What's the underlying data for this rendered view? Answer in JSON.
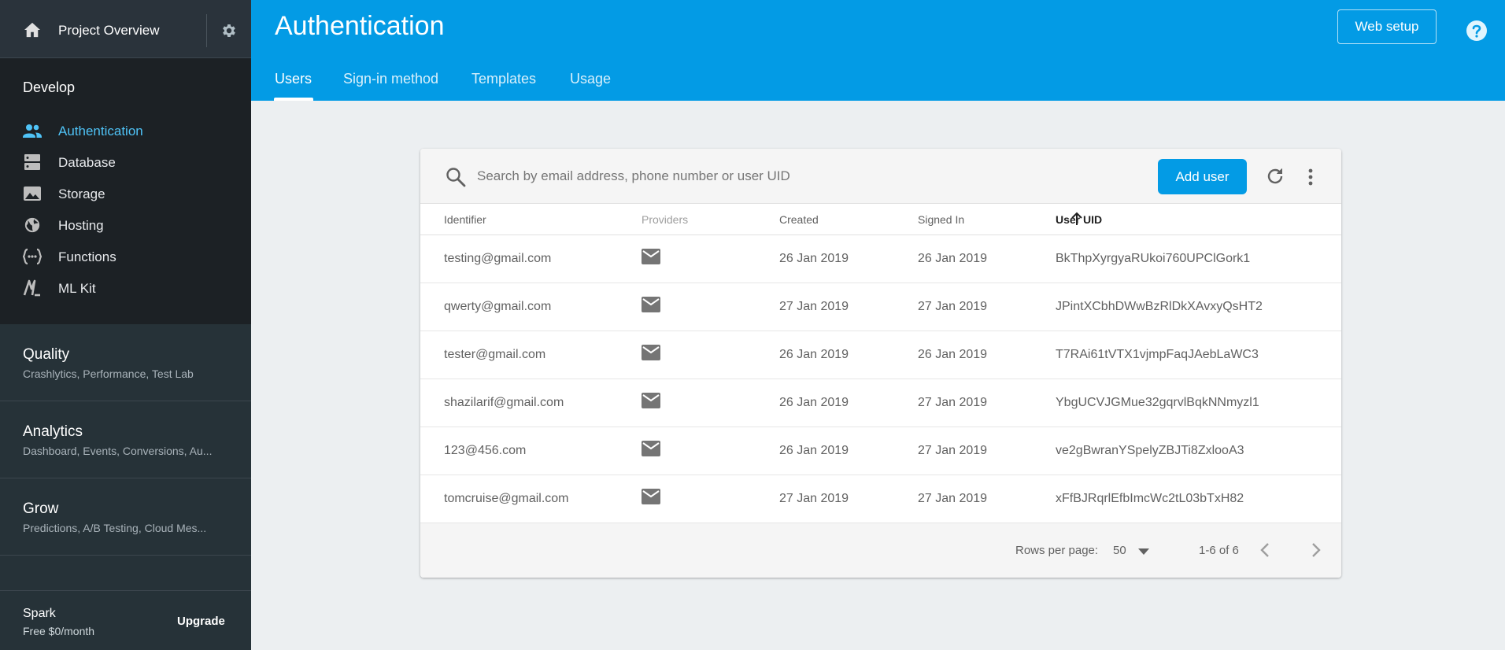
{
  "colors": {
    "header_blue": "#039be5",
    "sidebar_dark": "#263238",
    "sidebar_darker": "#1c2125",
    "active_accent": "#4fc3f7",
    "page_bg": "#eceff1"
  },
  "sidebar": {
    "project_label": "Project Overview",
    "develop": {
      "title": "Develop",
      "items": [
        {
          "label": "Authentication",
          "icon": "people-icon",
          "active": true
        },
        {
          "label": "Database",
          "icon": "database-icon"
        },
        {
          "label": "Storage",
          "icon": "image-icon"
        },
        {
          "label": "Hosting",
          "icon": "globe-icon"
        },
        {
          "label": "Functions",
          "icon": "functions-icon"
        },
        {
          "label": "ML Kit",
          "icon": "ml-kit-icon"
        }
      ]
    },
    "groups": [
      {
        "title": "Quality",
        "subtitle": "Crashlytics, Performance, Test Lab"
      },
      {
        "title": "Analytics",
        "subtitle": "Dashboard, Events, Conversions, Au..."
      },
      {
        "title": "Grow",
        "subtitle": "Predictions, A/B Testing, Cloud Mes..."
      }
    ],
    "plan": {
      "name": "Spark",
      "price": "Free $0/month",
      "upgrade_label": "Upgrade"
    }
  },
  "header": {
    "title": "Authentication",
    "web_setup_label": "Web setup",
    "tabs": [
      {
        "label": "Users",
        "active": true
      },
      {
        "label": "Sign-in method"
      },
      {
        "label": "Templates"
      },
      {
        "label": "Usage"
      }
    ]
  },
  "users_table": {
    "search_placeholder": "Search by email address, phone number or user UID",
    "add_user_label": "Add user",
    "columns": [
      "Identifier",
      "Providers",
      "Created",
      "Signed In",
      "User UID"
    ],
    "sorted_column": "User UID",
    "sort_direction": "ascending",
    "rows": [
      {
        "identifier": "testing@gmail.com",
        "provider": "email",
        "created": "26 Jan 2019",
        "signed_in": "26 Jan 2019",
        "uid": "BkThpXyrgyaRUkoi760UPClGork1"
      },
      {
        "identifier": "qwerty@gmail.com",
        "provider": "email",
        "created": "27 Jan 2019",
        "signed_in": "27 Jan 2019",
        "uid": "JPintXCbhDWwBzRlDkXAvxyQsHT2"
      },
      {
        "identifier": "tester@gmail.com",
        "provider": "email",
        "created": "26 Jan 2019",
        "signed_in": "26 Jan 2019",
        "uid": "T7RAi61tVTX1vjmpFaqJAebLaWC3"
      },
      {
        "identifier": "shazilarif@gmail.com",
        "provider": "email",
        "created": "26 Jan 2019",
        "signed_in": "27 Jan 2019",
        "uid": "YbgUCVJGMue32gqrvlBqkNNmyzl1"
      },
      {
        "identifier": "123@456.com",
        "provider": "email",
        "created": "26 Jan 2019",
        "signed_in": "27 Jan 2019",
        "uid": "ve2gBwranYSpelyZBJTi8ZxlooA3"
      },
      {
        "identifier": "tomcruise@gmail.com",
        "provider": "email",
        "created": "27 Jan 2019",
        "signed_in": "27 Jan 2019",
        "uid": "xFfBJRqrlEfbImcWc2tL03bTxH82"
      }
    ],
    "pagination": {
      "rows_per_page_label": "Rows per page:",
      "rows_per_page": "50",
      "range": "1-6 of 6"
    }
  }
}
